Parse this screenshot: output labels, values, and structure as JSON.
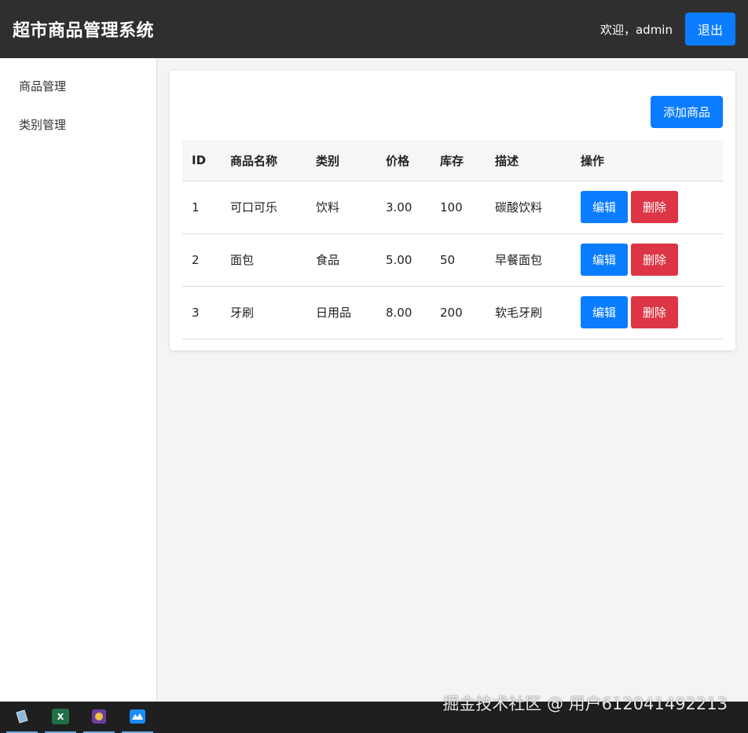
{
  "header": {
    "title": "超市商品管理系统",
    "welcome": "欢迎，admin",
    "logout_label": "退出"
  },
  "sidebar": {
    "items": [
      {
        "label": "商品管理"
      },
      {
        "label": "类别管理"
      }
    ]
  },
  "main": {
    "add_label": "添加商品",
    "columns": [
      "ID",
      "商品名称",
      "类别",
      "价格",
      "库存",
      "描述",
      "操作"
    ],
    "rows": [
      {
        "id": "1",
        "name": "可口可乐",
        "category": "饮料",
        "price": "3.00",
        "stock": "100",
        "desc": "碳酸饮料"
      },
      {
        "id": "2",
        "name": "面包",
        "category": "食品",
        "price": "5.00",
        "stock": "50",
        "desc": "早餐面包"
      },
      {
        "id": "3",
        "name": "牙刷",
        "category": "日用品",
        "price": "8.00",
        "stock": "200",
        "desc": "软毛牙刷"
      }
    ],
    "edit_label": "编辑",
    "delete_label": "删除"
  },
  "taskbar": {
    "icons": [
      "notepad-icon",
      "excel-icon",
      "game-icon",
      "app-icon"
    ]
  },
  "watermark": "掘金技术社区 @ 用户612041492213",
  "colors": {
    "primary": "#0a7cff",
    "danger": "#dc3545",
    "header_bg": "#2f2f2f"
  }
}
